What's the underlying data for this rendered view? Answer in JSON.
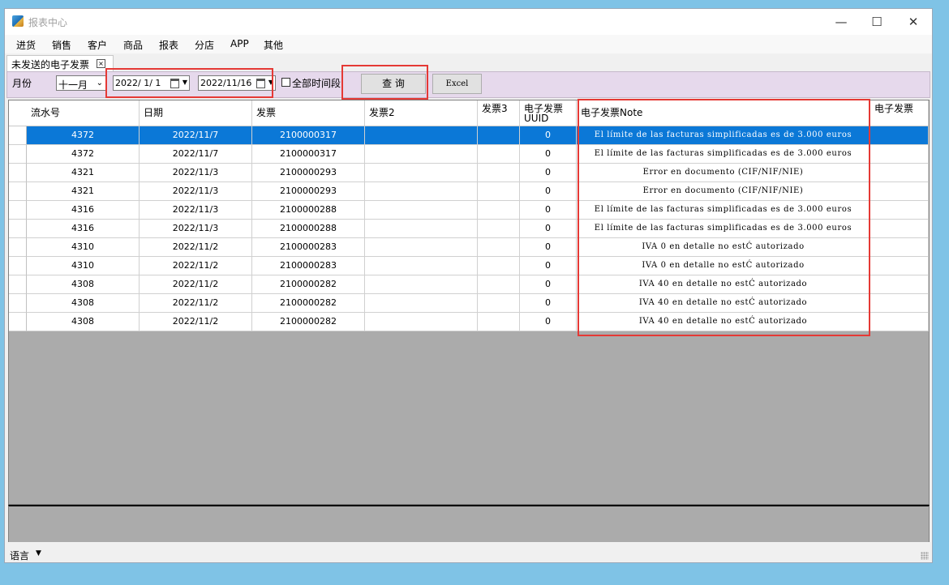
{
  "window": {
    "title": "报表中心",
    "minimize": "—",
    "maximize": "☐",
    "close": "✕"
  },
  "menu": [
    "进货",
    "销售",
    "客户",
    "商品",
    "报表",
    "分店",
    "APP",
    "其他"
  ],
  "tab": {
    "label": "未发送的电子发票",
    "close": "×"
  },
  "toolbar": {
    "month_label": "月份",
    "month_value": "十一月",
    "date_from": "2022/ 1/ 1",
    "date_to": "2022/11/16",
    "all_time_label": "全部时间段",
    "all_time_checked": false,
    "query_button": "查 询",
    "excel_button": "Excel"
  },
  "table": {
    "columns": [
      "流水号",
      "日期",
      "发票",
      "发票2",
      "发票3",
      "电子发票UUID",
      "电子发票Note",
      "电子发票"
    ],
    "rows": [
      [
        "4372",
        "2022/11/7",
        "2100000317",
        "",
        "",
        "0",
        "El límite de las facturas simplificadas es de 3.000 euros",
        ""
      ],
      [
        "4372",
        "2022/11/7",
        "2100000317",
        "",
        "",
        "0",
        "El límite de las facturas simplificadas es de 3.000 euros",
        ""
      ],
      [
        "4321",
        "2022/11/3",
        "2100000293",
        "",
        "",
        "0",
        "Error en documento (CIF/NIF/NIE)",
        ""
      ],
      [
        "4321",
        "2022/11/3",
        "2100000293",
        "",
        "",
        "0",
        "Error en documento (CIF/NIF/NIE)",
        ""
      ],
      [
        "4316",
        "2022/11/3",
        "2100000288",
        "",
        "",
        "0",
        "El límite de las facturas simplificadas es de 3.000 euros",
        ""
      ],
      [
        "4316",
        "2022/11/3",
        "2100000288",
        "",
        "",
        "0",
        "El límite de las facturas simplificadas es de 3.000 euros",
        ""
      ],
      [
        "4310",
        "2022/11/2",
        "2100000283",
        "",
        "",
        "0",
        "IVA 0 en detalle no estĆ autorizado",
        ""
      ],
      [
        "4310",
        "2022/11/2",
        "2100000283",
        "",
        "",
        "0",
        "IVA 0 en detalle no estĆ autorizado",
        ""
      ],
      [
        "4308",
        "2022/11/2",
        "2100000282",
        "",
        "",
        "0",
        "IVA 40 en detalle no estĆ autorizado",
        ""
      ],
      [
        "4308",
        "2022/11/2",
        "2100000282",
        "",
        "",
        "0",
        "IVA 40 en detalle no estĆ autorizado",
        ""
      ],
      [
        "4308",
        "2022/11/2",
        "2100000282",
        "",
        "",
        "0",
        "IVA 40 en detalle no estĆ autorizado",
        ""
      ]
    ],
    "selected_row": 0
  },
  "status": {
    "language_label": "语言"
  },
  "colors": {
    "selection": "#0b78d7",
    "toolbar_bg": "#e6d9ec",
    "highlight_box": "#e53935",
    "grid_empty": "#ababab"
  }
}
